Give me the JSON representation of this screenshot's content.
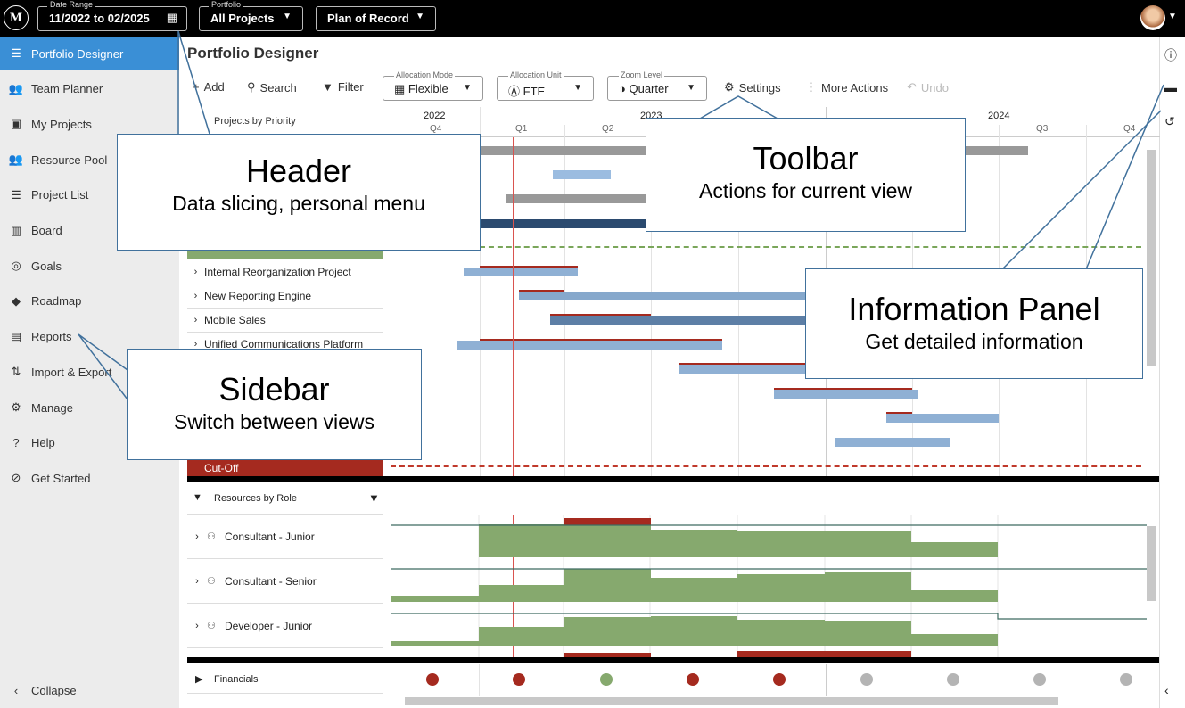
{
  "header": {
    "logo_text": "M",
    "date_range": {
      "label": "Date Range",
      "value": "11/2022 to 02/2025"
    },
    "portfolio": {
      "label": "Portfolio",
      "value": "All Projects"
    },
    "plan": {
      "value": "Plan of Record"
    }
  },
  "sidebar": {
    "items": [
      {
        "label": "Portfolio Designer",
        "icon": "sort-lines-icon",
        "glyph": "☰"
      },
      {
        "label": "Team Planner",
        "icon": "team-icon",
        "glyph": "👥"
      },
      {
        "label": "My Projects",
        "icon": "badge-icon",
        "glyph": "▣"
      },
      {
        "label": "Resource Pool",
        "icon": "people-icon",
        "glyph": "👥"
      },
      {
        "label": "Project List",
        "icon": "list-icon",
        "glyph": "☰"
      },
      {
        "label": "Board",
        "icon": "board-icon",
        "glyph": "▥"
      },
      {
        "label": "Goals",
        "icon": "target-icon",
        "glyph": "◎"
      },
      {
        "label": "Roadmap",
        "icon": "roadmap-icon",
        "glyph": "◆"
      },
      {
        "label": "Reports",
        "icon": "report-icon",
        "glyph": "▤"
      },
      {
        "label": "Import & Export",
        "icon": "import-export-icon",
        "glyph": "⇅"
      },
      {
        "label": "Manage",
        "icon": "gear-icon",
        "glyph": "⚙"
      },
      {
        "label": "Help",
        "icon": "help-icon",
        "glyph": "?"
      },
      {
        "label": "Get Started",
        "icon": "compass-icon",
        "glyph": "⊘"
      }
    ],
    "collapse_label": "Collapse"
  },
  "main": {
    "title": "Portfolio Designer",
    "toolbar": {
      "add": "Add",
      "search": "Search",
      "filter": "Filter",
      "allocation_mode": {
        "label": "Allocation Mode",
        "value": "Flexible"
      },
      "allocation_unit": {
        "label": "Allocation Unit",
        "value": "FTE"
      },
      "zoom_level": {
        "label": "Zoom Level",
        "value": "Quarter"
      },
      "settings": "Settings",
      "more_actions": "More Actions",
      "undo": "Undo"
    },
    "projects_header": "Projects by Priority",
    "timeline": {
      "years": [
        "2022",
        "2023",
        "2024"
      ],
      "quarters": [
        "Q4",
        "Q1",
        "Q2",
        "Q3",
        "Q4"
      ]
    },
    "projects": [
      "Internal Reorganization Project",
      "New Reporting Engine",
      "Mobile Sales",
      "Unified Communications Platform"
    ],
    "cutoff_label": "Cut-Off",
    "resources_header": "Resources by Role",
    "roles": [
      "Consultant - Junior",
      "Consultant - Senior",
      "Developer - Junior"
    ],
    "financials_label": "Financials",
    "financial_dot_colors": [
      "#a52a1f",
      "#a52a1f",
      "#86a96e",
      "#a52a1f",
      "#a52a1f",
      "#b4b4b4",
      "#b4b4b4",
      "#b4b4b4",
      "#b4b4b4"
    ]
  },
  "callouts": {
    "header": {
      "title": "Header",
      "subtitle": "Data slicing, personal menu"
    },
    "toolbar": {
      "title": "Toolbar",
      "subtitle": "Actions for current view"
    },
    "info": {
      "title": "Information Panel",
      "subtitle": "Get detailed information"
    },
    "sidebar": {
      "title": "Sidebar",
      "subtitle": "Switch between views"
    }
  },
  "colors": {
    "accent": "#3a8fd6",
    "cutoff": "#a52a1f",
    "bar_light": "#8fb0d4",
    "bar_gray": "#999999",
    "bar_dark": "#2b4a6f",
    "resource_fill": "#86a96e",
    "callout_border": "#41719c"
  }
}
